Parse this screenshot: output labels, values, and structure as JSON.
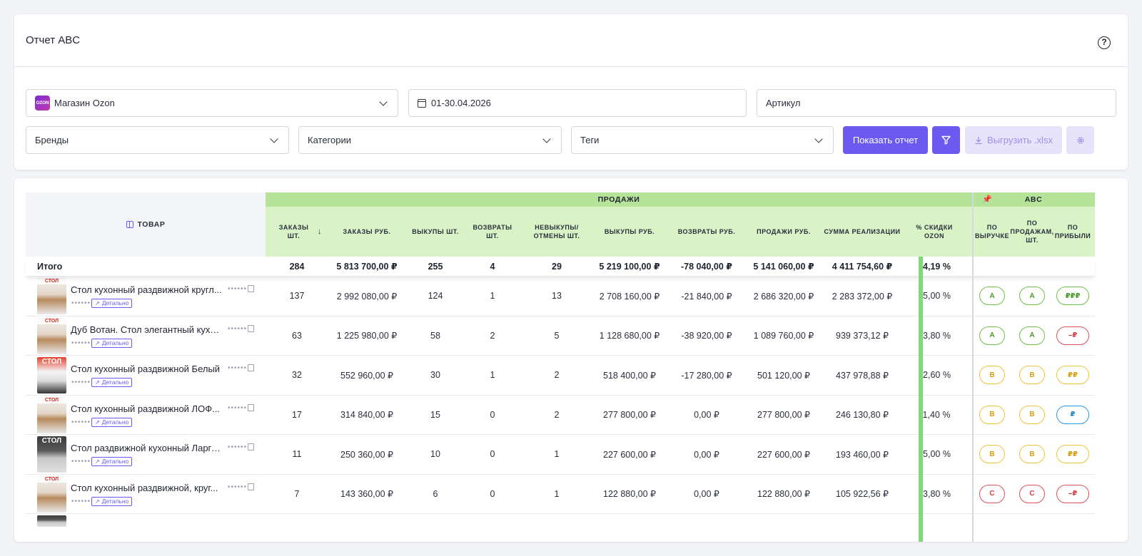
{
  "page": {
    "title": "Отчет ABC"
  },
  "filters": {
    "store": {
      "logo_text": "OZON",
      "value": "Магазин Ozon"
    },
    "period": "01-30.04.2026",
    "article_placeholder": "Артикул",
    "brands": "Бренды",
    "categories": "Категории",
    "tags": "Теги",
    "show_report": "Показать отчет",
    "export": "Выгрузить .xlsx"
  },
  "table": {
    "product_header": "ТОВАР",
    "sales_group": "ПРОДАЖИ",
    "abc_group": "ABC",
    "columns": [
      "ЗАКАЗЫ ШТ.",
      "ЗАКАЗЫ РУБ.",
      "ВЫКУПЫ ШТ.",
      "ВОЗВРАТЫ ШТ.",
      "НЕВЫКУПЫ/ ОТМЕНЫ ШТ.",
      "ВЫКУПЫ РУБ.",
      "ВОЗВРАТЫ РУБ.",
      "ПРОДАЖИ РУБ.",
      "СУММА РЕАЛИЗАЦИИ",
      "% СКИДКИ OZON"
    ],
    "abc_columns": [
      "ПО ВЫРУЧКЕ",
      "ПО ПРОДАЖАМ, ШТ.",
      "ПО ПРИБЫЛИ"
    ],
    "total": {
      "label": "Итого",
      "values": [
        "284",
        "5 813 700,00 ₽",
        "255",
        "4",
        "29",
        "5 219 100,00 ₽",
        "-78 040,00 ₽",
        "5 141 060,00 ₽",
        "4 411 754,60 ₽",
        "14,19 %"
      ]
    },
    "detail_label": "Детально",
    "rows": [
      {
        "name": "Стол кухонный раздвижной кругл...",
        "thumb_label": "СТОЛ",
        "values": [
          "137",
          "2 992 080,00 ₽",
          "124",
          "1",
          "13",
          "2 708 160,00 ₽",
          "-21 840,00 ₽",
          "2 686 320,00 ₽",
          "2 283 372,00 ₽",
          "15,00 %"
        ],
        "abc": [
          "A",
          "A",
          "₽₽₽"
        ]
      },
      {
        "name": "Дуб Вотан. Стол элегантный кухо...",
        "thumb_label": "СТОЛ",
        "values": [
          "63",
          "1 225 980,00 ₽",
          "58",
          "2",
          "5",
          "1 128 680,00 ₽",
          "-38 920,00 ₽",
          "1 089 760,00 ₽",
          "939 373,12 ₽",
          "13,80 %"
        ],
        "abc": [
          "A",
          "A",
          "–₽"
        ]
      },
      {
        "name": "Стол кухонный раздвижной Белый",
        "thumb_label": "СТОЛ",
        "values": [
          "32",
          "552 960,00 ₽",
          "30",
          "1",
          "2",
          "518 400,00 ₽",
          "-17 280,00 ₽",
          "501 120,00 ₽",
          "437 978,88 ₽",
          "12,60 %"
        ],
        "abc": [
          "B",
          "B",
          "₽₽"
        ]
      },
      {
        "name": "Стол кухонный раздвижной ЛОФ...",
        "thumb_label": "СТОЛ",
        "values": [
          "17",
          "314 840,00 ₽",
          "15",
          "0",
          "2",
          "277 800,00 ₽",
          "0,00 ₽",
          "277 800,00 ₽",
          "246 130,80 ₽",
          "11,40 %"
        ],
        "abc": [
          "B",
          "B",
          "₽"
        ]
      },
      {
        "name": "Стол раздвижной кухонный Ларго...",
        "thumb_label": "СТОЛ",
        "values": [
          "11",
          "250 360,00 ₽",
          "10",
          "0",
          "1",
          "227 600,00 ₽",
          "0,00 ₽",
          "227 600,00 ₽",
          "193 460,00 ₽",
          "15,00 %"
        ],
        "abc": [
          "B",
          "B",
          "₽₽"
        ]
      },
      {
        "name": "Стол кухонный раздвижной, круг...",
        "thumb_label": "СТОЛ",
        "values": [
          "7",
          "143 360,00 ₽",
          "6",
          "0",
          "1",
          "122 880,00 ₽",
          "0,00 ₽",
          "122 880,00 ₽",
          "105 922,56 ₽",
          "13,80 %"
        ],
        "abc": [
          "C",
          "C",
          "–₽"
        ]
      }
    ]
  },
  "colors": {
    "accent": "#6b5af0",
    "sales_header": "#b6e39a",
    "sales_subheader": "#d9f3c7",
    "grade_a": "#6cc24a",
    "grade_b": "#f0c23a",
    "grade_c": "#e0525b",
    "grade_blue": "#2a9fe0"
  },
  "icons": [
    "help-icon",
    "chevron-down-icon",
    "calendar-icon",
    "filter-icon",
    "download-icon",
    "gear-icon",
    "columns-icon",
    "sort-down-icon",
    "pin-icon",
    "copy-icon",
    "external-link-icon"
  ]
}
